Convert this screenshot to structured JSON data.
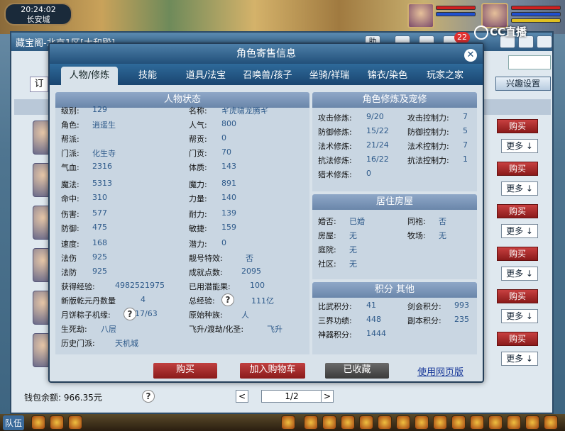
{
  "hud": {
    "time": "20:24:02",
    "location": "长安城"
  },
  "stream": {
    "logo": "CC直播",
    "notify_count": "22"
  },
  "shop": {
    "title": "藏宝阁-北京1区[太和殿]",
    "help_btn": "助",
    "order_btn": "订",
    "interest_btn": "兴趣设置",
    "buy_label": "购买",
    "more_label": "更多 ↓",
    "wallet": "钱包余额: 966.35元",
    "help_icon": "?",
    "page": "1/2",
    "prev": "<",
    "next": ">"
  },
  "modal": {
    "title": "角色寄售信息",
    "close": "✕",
    "tabs": [
      "人物/修炼",
      "技能",
      "道具/法宝",
      "召唤兽/孩子",
      "坐骑/祥瑞",
      "锦衣/染色",
      "玩家之家"
    ],
    "status_title": "人物状态",
    "left_col": [
      {
        "label": "级别:",
        "value": "129"
      },
      {
        "label": "角色:",
        "value": "逍遥生"
      },
      {
        "label": "帮派:",
        "value": ""
      },
      {
        "label": "门派:",
        "value": "化生寺"
      },
      {
        "label": "气血:",
        "value": "2316"
      },
      {
        "label": "魔法:",
        "value": "5313"
      },
      {
        "label": "命中:",
        "value": "310"
      },
      {
        "label": "伤害:",
        "value": "577"
      },
      {
        "label": "防御:",
        "value": "475"
      },
      {
        "label": "速度:",
        "value": "168"
      },
      {
        "label": "法伤",
        "value": "925"
      },
      {
        "label": "法防",
        "value": "925"
      },
      {
        "label": "获得经验:",
        "value": "4982521975"
      },
      {
        "label": "新版乾元丹数量",
        "value": "4"
      },
      {
        "label": "月饼粽子机缘:",
        "value": "17/63"
      },
      {
        "label": "生死劫:",
        "value": "八层"
      },
      {
        "label": "历史门派:",
        "value": "天机城"
      }
    ],
    "mid_col": [
      {
        "label": "名称:",
        "value": "ギ虎啸龙腾ギ"
      },
      {
        "label": "人气:",
        "value": "800"
      },
      {
        "label": "帮贡:",
        "value": "0"
      },
      {
        "label": "门贡:",
        "value": "70"
      },
      {
        "label": "体质:",
        "value": "143"
      },
      {
        "label": "魔力:",
        "value": "891"
      },
      {
        "label": "力量:",
        "value": "140"
      },
      {
        "label": "耐力:",
        "value": "139"
      },
      {
        "label": "敏捷:",
        "value": "159"
      },
      {
        "label": "潜力:",
        "value": "0"
      },
      {
        "label": "靓号特效:",
        "value": "否"
      },
      {
        "label": "成就点数:",
        "value": "2095"
      },
      {
        "label": "已用潜能果:",
        "value": "100"
      },
      {
        "label": "总经验:",
        "value": "111亿"
      },
      {
        "label": "原始种族:",
        "value": "人"
      },
      {
        "label": "飞升/渡劫/化圣:",
        "value": "飞升"
      }
    ],
    "cultivation_title": "角色修炼及宠修",
    "cultivation": [
      {
        "label": "攻击修炼:",
        "value": "9/20",
        "label2": "攻击控制力:",
        "value2": "7"
      },
      {
        "label": "防御修炼:",
        "value": "15/22",
        "label2": "防御控制力:",
        "value2": "5"
      },
      {
        "label": "法术修炼:",
        "value": "21/24",
        "label2": "法术控制力:",
        "value2": "7"
      },
      {
        "label": "抗法修炼:",
        "value": "16/22",
        "label2": "抗法控制力:",
        "value2": "1"
      },
      {
        "label": "猎术修炼:",
        "value": "0",
        "label2": "",
        "value2": ""
      }
    ],
    "house_title": "居住房屋",
    "house": [
      {
        "label": "婚否:",
        "value": "已婚",
        "label2": "同袍:",
        "value2": "否"
      },
      {
        "label": "房屋:",
        "value": "无",
        "label2": "牧场:",
        "value2": "无"
      },
      {
        "label": "庭院:",
        "value": "无",
        "label2": "",
        "value2": ""
      },
      {
        "label": "社区:",
        "value": "无",
        "label2": "",
        "value2": ""
      }
    ],
    "score_title": "积分 其他",
    "score": [
      {
        "label": "比武积分:",
        "value": "41",
        "label2": "剑会积分:",
        "value2": "993"
      },
      {
        "label": "三界功绩:",
        "value": "448",
        "label2": "副本积分:",
        "value2": "235"
      },
      {
        "label": "神器积分:",
        "value": "1444",
        "label2": "",
        "value2": ""
      }
    ],
    "buttons": {
      "buy": "购买",
      "cart": "加入购物车",
      "collected": "已收藏",
      "web": "使用网页版"
    },
    "help": "?"
  },
  "bottom": {
    "team": "队伍"
  },
  "colors": {
    "header_blue": "#22507a",
    "buy_red": "#a02020",
    "value_blue": "#2e5a8a"
  }
}
